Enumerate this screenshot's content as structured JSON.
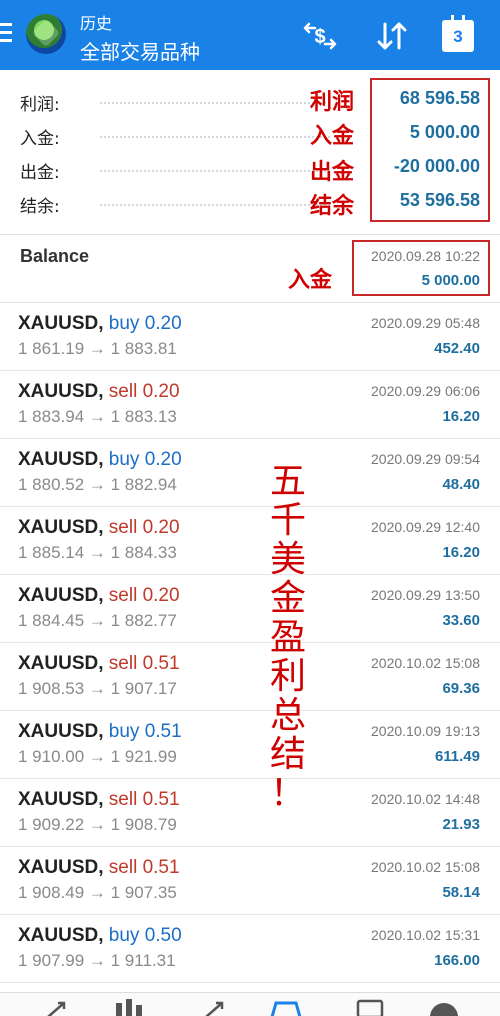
{
  "header": {
    "title": "历史",
    "subtitle": "全部交易品种",
    "icons": [
      "menu-icon",
      "app-logo",
      "currency-exchange-icon",
      "sort-icon",
      "calendar-icon"
    ],
    "calendar_day": "3",
    "color": "#1a82e6"
  },
  "summary": {
    "rows": [
      {
        "label": "利润:",
        "value": "68 596.58",
        "annotation": "利润"
      },
      {
        "label": "入金:",
        "value": "5 000.00",
        "annotation": "入金"
      },
      {
        "label": "出金:",
        "value": "-20 000.00",
        "annotation": "出金"
      },
      {
        "label": "结余:",
        "value": "53 596.58",
        "annotation": "结余"
      }
    ]
  },
  "balance": {
    "label": "Balance",
    "time": "2020.09.28 10:22",
    "amount": "5 000.00",
    "annotation": "入金"
  },
  "trades": [
    {
      "symbol": "XAUUSD,",
      "side": "buy 0.20",
      "type": "buy",
      "prices": "1 861.19 → 1 883.81",
      "time": "2020.09.29 05:48",
      "profit": "452.40"
    },
    {
      "symbol": "XAUUSD,",
      "side": "sell 0.20",
      "type": "sell",
      "prices": "1 883.94 → 1 883.13",
      "time": "2020.09.29 06:06",
      "profit": "16.20"
    },
    {
      "symbol": "XAUUSD,",
      "side": "buy 0.20",
      "type": "buy",
      "prices": "1 880.52 → 1 882.94",
      "time": "2020.09.29 09:54",
      "profit": "48.40"
    },
    {
      "symbol": "XAUUSD,",
      "side": "sell 0.20",
      "type": "sell",
      "prices": "1 885.14 → 1 884.33",
      "time": "2020.09.29 12:40",
      "profit": "16.20"
    },
    {
      "symbol": "XAUUSD,",
      "side": "sell 0.20",
      "type": "sell",
      "prices": "1 884.45 → 1 882.77",
      "time": "2020.09.29 13:50",
      "profit": "33.60"
    },
    {
      "symbol": "XAUUSD,",
      "side": "sell 0.51",
      "type": "sell",
      "prices": "1 908.53 → 1 907.17",
      "time": "2020.10.02 15:08",
      "profit": "69.36"
    },
    {
      "symbol": "XAUUSD,",
      "side": "buy 0.51",
      "type": "buy",
      "prices": "1 910.00 → 1 921.99",
      "time": "2020.10.09 19:13",
      "profit": "611.49"
    },
    {
      "symbol": "XAUUSD,",
      "side": "sell 0.51",
      "type": "sell",
      "prices": "1 909.22 → 1 908.79",
      "time": "2020.10.02 14:48",
      "profit": "21.93"
    },
    {
      "symbol": "XAUUSD,",
      "side": "sell 0.51",
      "type": "sell",
      "prices": "1 908.49 → 1 907.35",
      "time": "2020.10.02 15:08",
      "profit": "58.14"
    },
    {
      "symbol": "XAUUSD,",
      "side": "buy 0.50",
      "type": "buy",
      "prices": "1 907.99 → 1 911.31",
      "time": "2020.10.02 15:31",
      "profit": "166.00"
    }
  ],
  "vertical_annotation": [
    "五",
    "千",
    "美",
    "金",
    "盈",
    "利",
    "总",
    "结",
    "！"
  ],
  "colors": {
    "annotation_red": "#d00000",
    "buy": "#1a6fc4",
    "sell": "#c0392b",
    "value_blue": "#1e6fa0"
  },
  "tabbar": {
    "icons": [
      "quotes-tab-icon",
      "chart-tab-icon",
      "trade-tab-icon",
      "history-tab-icon",
      "messages-tab-icon",
      "settings-tab-icon"
    ]
  }
}
